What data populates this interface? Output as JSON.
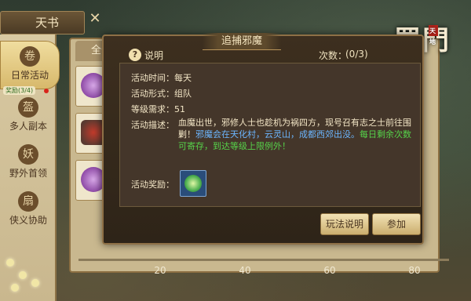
{
  "panel": {
    "title": "天书",
    "close_glyph": "✕"
  },
  "logo": {
    "text": "蜀門",
    "seal": "天地"
  },
  "sidebar": {
    "items": [
      {
        "label": "日常活动",
        "icon": "scroll-icon",
        "active": true,
        "badge": "奖励(3/4)"
      },
      {
        "label": "多人副本",
        "icon": "helmet-icon",
        "active": false
      },
      {
        "label": "野外首领",
        "icon": "demon-icon",
        "active": false
      },
      {
        "label": "侠义协助",
        "icon": "fan-icon",
        "active": false
      }
    ]
  },
  "list": {
    "tab_label": "全部"
  },
  "progress_axis": {
    "ticks": [
      "20",
      "40",
      "60",
      "80"
    ]
  },
  "modal": {
    "title": "追捕邪魔",
    "help_label": "说明",
    "count_label": "次数：",
    "count_value": "(0/3)",
    "rows": {
      "time_label": "活动时间：",
      "time_value": "每天",
      "form_label": "活动形式：",
      "form_value": "组队",
      "level_label": "等级需求：",
      "level_value": "51",
      "desc_label": "活动描述："
    },
    "desc_white": "血魔出世，邪修人士也趁机为祸四方，现号召有志之士前往围剿！",
    "desc_blue": "邪魔会在天化村，云灵山，成都西郊出没。",
    "desc_green": "每日剩余次数可寄存，到达等级上限例外！",
    "reward_label": "活动奖励：",
    "reward_icon": "reward-orb-icon",
    "buttons": {
      "rules": "玩法说明",
      "join": "参加"
    }
  }
}
